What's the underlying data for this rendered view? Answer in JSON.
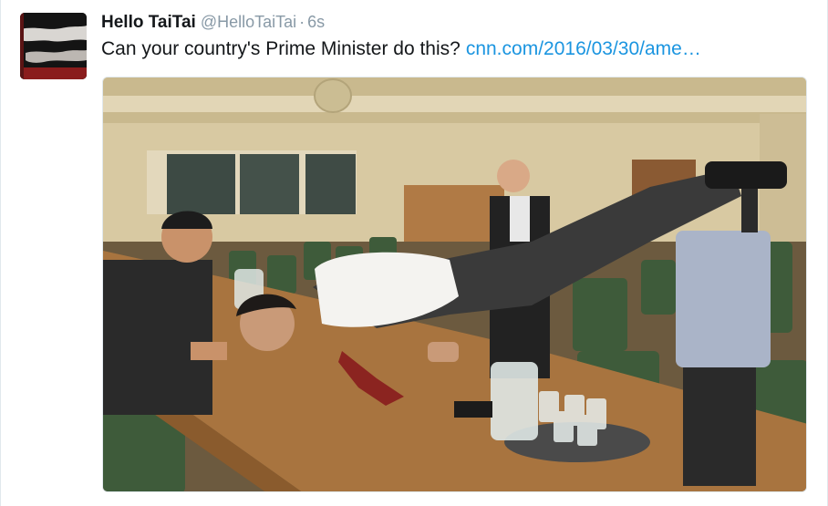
{
  "tweet": {
    "display_name": "Hello TaiTai",
    "handle": "@HelloTaiTai",
    "separator": "·",
    "timestamp": "6s",
    "text": "Can your country's Prime Minister do this?",
    "link_text": "cnn.com/2016/03/30/ame…"
  },
  "colors": {
    "name": "#14171a",
    "meta": "#8899a6",
    "link": "#1b95e0"
  }
}
